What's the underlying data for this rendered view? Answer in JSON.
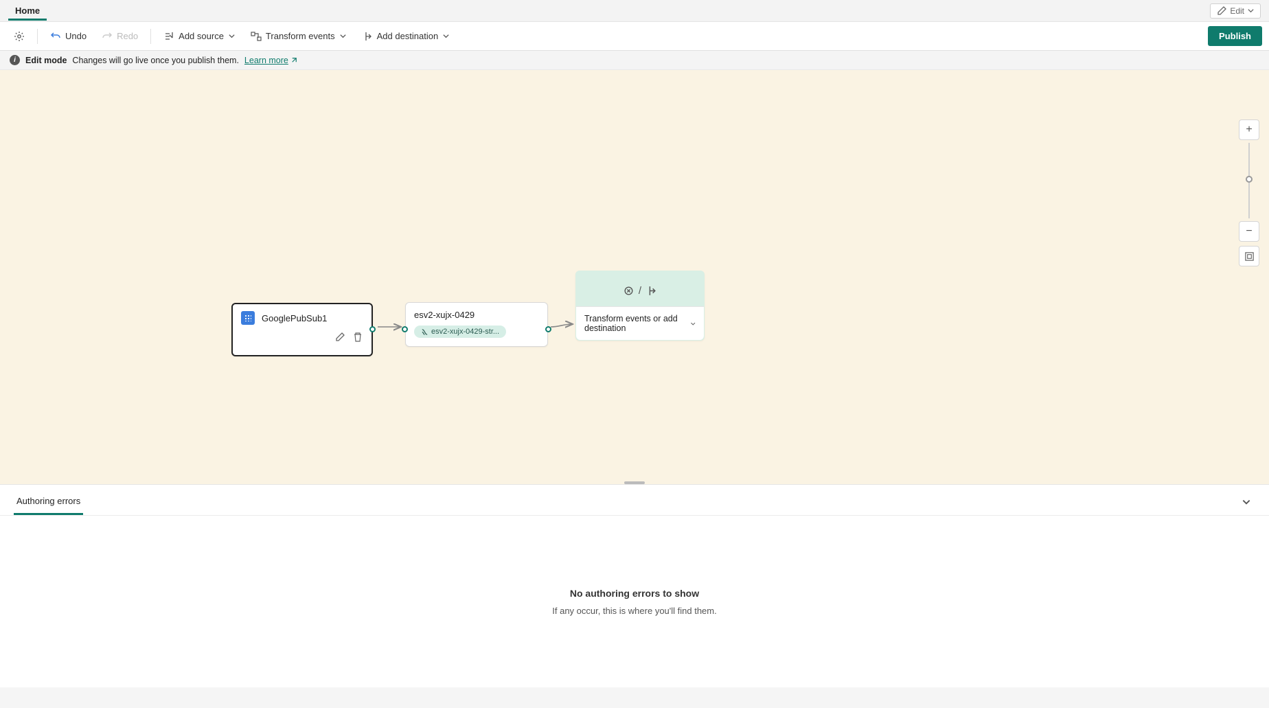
{
  "topbar": {
    "tab": "Home",
    "edit_dd": "Edit"
  },
  "toolbar": {
    "undo": "Undo",
    "redo": "Redo",
    "add_source": "Add source",
    "transform": "Transform events",
    "add_dest": "Add destination",
    "publish": "Publish"
  },
  "infobar": {
    "mode": "Edit mode",
    "msg": "Changes will go live once you publish them.",
    "link": "Learn more"
  },
  "canvas": {
    "source": {
      "title": "GooglePubSub1"
    },
    "stream": {
      "title": "esv2-xujx-0429",
      "chip": "esv2-xujx-0429-str..."
    },
    "add": {
      "label": "Transform events or add destination"
    }
  },
  "panel": {
    "tab": "Authoring errors",
    "empty_title": "No authoring errors to show",
    "empty_sub": "If any occur, this is where you'll find them."
  }
}
